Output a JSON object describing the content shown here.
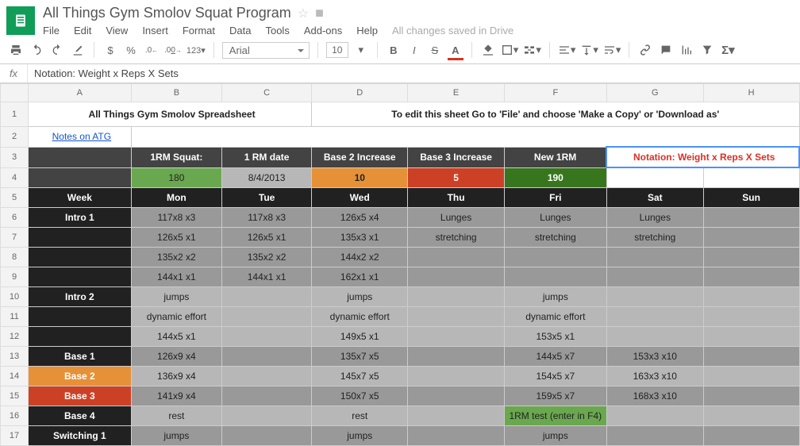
{
  "doc": {
    "title": "All Things Gym Smolov Squat Program",
    "saved": "All changes saved in Drive"
  },
  "menu": {
    "file": "File",
    "edit": "Edit",
    "view": "View",
    "insert": "Insert",
    "format": "Format",
    "data": "Data",
    "tools": "Tools",
    "addons": "Add-ons",
    "help": "Help"
  },
  "toolbar": {
    "currency": "$",
    "percent": "%",
    "dec_dec": ".0←",
    "inc_dec": ".00→",
    "numfmt": "123",
    "font": "Arial",
    "size": "10",
    "bold": "B",
    "italic": "I",
    "strike": "S",
    "textA": "A"
  },
  "fx": {
    "label": "fx",
    "value": "Notation: Weight x Reps X Sets"
  },
  "cols": [
    "A",
    "B",
    "C",
    "D",
    "E",
    "F",
    "G",
    "H"
  ],
  "rows": [
    "1",
    "2",
    "3",
    "4",
    "5",
    "6",
    "7",
    "8",
    "9",
    "10",
    "11",
    "12",
    "13",
    "14",
    "15",
    "16",
    "17"
  ],
  "sheet": {
    "title": "All Things Gym Smolov Spreadsheet",
    "subtitle": "To edit this sheet Go to 'File' and choose 'Make a Copy' or 'Download as'",
    "notes": "Notes on ATG",
    "headers": {
      "b": "1RM Squat:",
      "c": "1 RM date",
      "d": "Base 2 Increase",
      "e": "Base 3 Increase",
      "f": "New 1RM"
    },
    "notation": "Notation: Weight x Reps X Sets",
    "vals": {
      "b": "180",
      "c": "8/4/2013",
      "d": "10",
      "e": "5",
      "f": "190"
    },
    "days": {
      "a": "Week",
      "b": "Mon",
      "c": "Tue",
      "d": "Wed",
      "e": "Thu",
      "f": "Fri",
      "g": "Sat",
      "h": "Sun"
    },
    "r6": {
      "a": "Intro 1",
      "b": "117x8 x3",
      "c": "117x8 x3",
      "d": "126x5 x4",
      "e": "Lunges",
      "f": "Lunges",
      "g": "Lunges"
    },
    "r7": {
      "b": "126x5 x1",
      "c": "126x5 x1",
      "d": "135x3 x1",
      "e": "stretching",
      "f": "stretching",
      "g": "stretching"
    },
    "r8": {
      "b": "135x2 x2",
      "c": "135x2 x2",
      "d": "144x2 x2"
    },
    "r9": {
      "b": "144x1 x1",
      "c": "144x1 x1",
      "d": "162x1 x1"
    },
    "r10": {
      "a": "Intro 2",
      "b": "jumps",
      "d": "jumps",
      "f": "jumps"
    },
    "r11": {
      "b": "dynamic effort",
      "d": "dynamic effort",
      "f": "dynamic effort"
    },
    "r12": {
      "b": "144x5 x1",
      "d": "149x5 x1",
      "f": "153x5 x1"
    },
    "r13": {
      "a": "Base 1",
      "b": "126x9 x4",
      "d": "135x7 x5",
      "f": "144x5 x7",
      "g": "153x3 x10"
    },
    "r14": {
      "a": "Base 2",
      "b": "136x9 x4",
      "d": "145x7 x5",
      "f": "154x5 x7",
      "g": "163x3 x10"
    },
    "r15": {
      "a": "Base 3",
      "b": "141x9 x4",
      "d": "150x7 x5",
      "f": "159x5 x7",
      "g": "168x3 x10"
    },
    "r16": {
      "a": "Base 4",
      "b": "rest",
      "d": "rest",
      "f": "1RM test (enter in F4)"
    },
    "r17": {
      "a": "Switching 1",
      "b": "jumps",
      "d": "jumps",
      "f": "jumps"
    }
  },
  "chart_data": {
    "type": "table",
    "title": "All Things Gym Smolov Spreadsheet",
    "inputs": {
      "1RM Squat": 180,
      "1 RM date": "8/4/2013",
      "Base 2 Increase": 10,
      "Base 3 Increase": 5,
      "New 1RM": 190
    },
    "columns": [
      "Week",
      "Mon",
      "Tue",
      "Wed",
      "Thu",
      "Fri",
      "Sat",
      "Sun"
    ],
    "rows": [
      [
        "Intro 1",
        "117x8 x3",
        "117x8 x3",
        "126x5 x4",
        "Lunges",
        "Lunges",
        "Lunges",
        ""
      ],
      [
        "",
        "126x5 x1",
        "126x5 x1",
        "135x3 x1",
        "stretching",
        "stretching",
        "stretching",
        ""
      ],
      [
        "",
        "135x2 x2",
        "135x2 x2",
        "144x2 x2",
        "",
        "",
        "",
        ""
      ],
      [
        "",
        "144x1 x1",
        "144x1 x1",
        "162x1 x1",
        "",
        "",
        "",
        ""
      ],
      [
        "Intro 2",
        "jumps",
        "",
        "jumps",
        "",
        "jumps",
        "",
        ""
      ],
      [
        "",
        "dynamic effort",
        "",
        "dynamic effort",
        "",
        "dynamic effort",
        "",
        ""
      ],
      [
        "",
        "144x5 x1",
        "",
        "149x5 x1",
        "",
        "153x5 x1",
        "",
        ""
      ],
      [
        "Base 1",
        "126x9 x4",
        "",
        "135x7 x5",
        "",
        "144x5 x7",
        "153x3 x10",
        ""
      ],
      [
        "Base 2",
        "136x9 x4",
        "",
        "145x7 x5",
        "",
        "154x5 x7",
        "163x3 x10",
        ""
      ],
      [
        "Base 3",
        "141x9 x4",
        "",
        "150x7 x5",
        "",
        "159x5 x7",
        "168x3 x10",
        ""
      ],
      [
        "Base 4",
        "rest",
        "",
        "rest",
        "",
        "1RM test (enter in F4)",
        "",
        ""
      ],
      [
        "Switching 1",
        "jumps",
        "",
        "jumps",
        "",
        "jumps",
        "",
        ""
      ]
    ]
  }
}
